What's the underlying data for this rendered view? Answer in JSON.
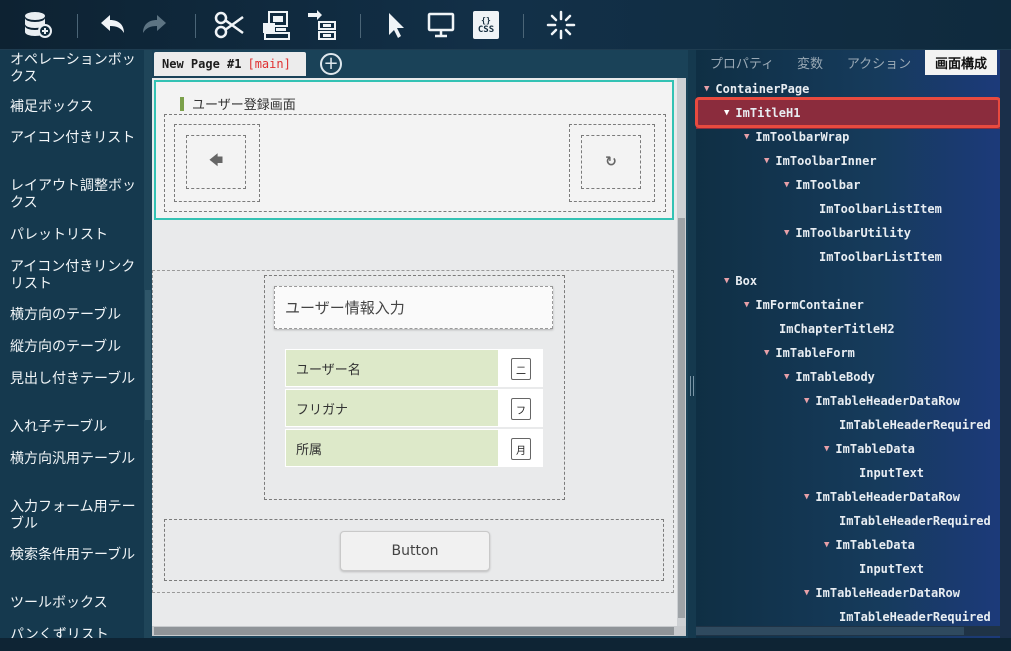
{
  "toolbar": {
    "buttons": [
      {
        "name": "database-icon"
      },
      {
        "name": "undo-icon"
      },
      {
        "name": "redo-icon"
      },
      {
        "name": "cut-icon"
      },
      {
        "name": "component-icon"
      },
      {
        "name": "tree-move-icon"
      },
      {
        "name": "pointer-icon"
      },
      {
        "name": "monitor-icon"
      },
      {
        "name": "css-icon",
        "label": "CSS"
      },
      {
        "name": "loading-icon"
      }
    ]
  },
  "palette": {
    "items": [
      "オペレーションボックス",
      "補足ボックス",
      "アイコン付きリスト",
      "レイアウト調整ボックス",
      "パレットリスト",
      "アイコン付きリンクリスト",
      "横方向のテーブル",
      "縦方向のテーブル",
      "見出し付きテーブル",
      "入れ子テーブル",
      "横方向汎用テーブル",
      "入力フォーム用テーブル",
      "検索条件用テーブル",
      "ツールボックス",
      "パンくずリスト"
    ]
  },
  "editor": {
    "tab_label": "New Page #1",
    "tab_tag": "[main]",
    "add_tab_symbol": "+",
    "page_title": "ユーザー登録画面",
    "back_symbol": "🡄",
    "reload_symbol": "↻",
    "chapter_title": "ユーザー情報入力",
    "rows": [
      {
        "label": "ユーザー名",
        "input_text": "二"
      },
      {
        "label": "フリガナ",
        "input_text": "フ"
      },
      {
        "label": "所属",
        "input_text": "月"
      }
    ],
    "button_label": "Button"
  },
  "right_panel": {
    "tabs": [
      "プロパティ",
      "変数",
      "アクション",
      "画面構成"
    ],
    "active_tab": "画面構成",
    "tree": [
      {
        "label": "ContainerPage",
        "depth": 0,
        "arrow": true
      },
      {
        "label": "ImTitleH1",
        "depth": 1,
        "arrow": true,
        "selected": true
      },
      {
        "label": "ImToolbarWrap",
        "depth": 2,
        "arrow": true
      },
      {
        "label": "ImToolbarInner",
        "depth": 3,
        "arrow": true
      },
      {
        "label": "ImToolbar",
        "depth": 4,
        "arrow": true
      },
      {
        "label": "ImToolbarListItem",
        "depth": 5,
        "arrow": false
      },
      {
        "label": "ImToolbarUtility",
        "depth": 4,
        "arrow": true
      },
      {
        "label": "ImToolbarListItem",
        "depth": 5,
        "arrow": false
      },
      {
        "label": "Box",
        "depth": 1,
        "arrow": true
      },
      {
        "label": "ImFormContainer",
        "depth": 2,
        "arrow": true
      },
      {
        "label": "ImChapterTitleH2",
        "depth": 3,
        "arrow": false
      },
      {
        "label": "ImTableForm",
        "depth": 3,
        "arrow": true
      },
      {
        "label": "ImTableBody",
        "depth": 4,
        "arrow": true
      },
      {
        "label": "ImTableHeaderDataRow",
        "depth": 5,
        "arrow": true
      },
      {
        "label": "ImTableHeaderRequired",
        "depth": 6,
        "arrow": false
      },
      {
        "label": "ImTableData",
        "depth": 6,
        "arrow": true
      },
      {
        "label": "InputText",
        "depth": 7,
        "arrow": false
      },
      {
        "label": "ImTableHeaderDataRow",
        "depth": 5,
        "arrow": true
      },
      {
        "label": "ImTableHeaderRequired",
        "depth": 6,
        "arrow": false
      },
      {
        "label": "ImTableData",
        "depth": 6,
        "arrow": true
      },
      {
        "label": "InputText",
        "depth": 7,
        "arrow": false
      },
      {
        "label": "ImTableHeaderDataRow",
        "depth": 5,
        "arrow": true
      },
      {
        "label": "ImTableHeaderRequired",
        "depth": 6,
        "arrow": false
      }
    ]
  },
  "colors": {
    "selection_bg": "#8b2c3d",
    "selection_outline": "#e84a3f",
    "focus_outline": "#33c2b4",
    "table_header": "#dde9c9"
  }
}
